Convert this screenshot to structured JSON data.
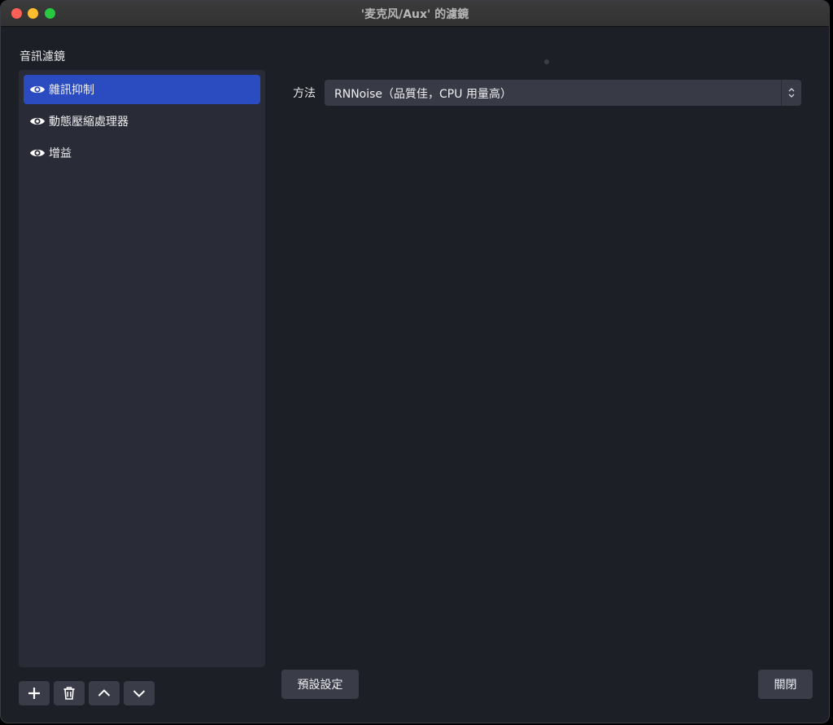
{
  "window": {
    "title": "'麦克风/Aux' 的濾鏡"
  },
  "filters": {
    "section_label": "音訊濾鏡",
    "items": [
      {
        "label": "雜訊抑制",
        "selected": true,
        "visible_icon": "eye-icon"
      },
      {
        "label": "動態壓縮處理器",
        "selected": false,
        "visible_icon": "eye-icon"
      },
      {
        "label": "增益",
        "selected": false,
        "visible_icon": "eye-icon"
      }
    ],
    "toolbar": {
      "add_icon": "plus-icon",
      "remove_icon": "trash-icon",
      "up_icon": "chevron-up-icon",
      "down_icon": "chevron-down-icon"
    }
  },
  "properties": {
    "method_label": "方法",
    "method_value": "RNNoise（品質佳，CPU 用量高）"
  },
  "buttons": {
    "defaults_label": "預設設定",
    "close_label": "關閉"
  },
  "colors": {
    "accent": "#2a4cc0",
    "background": "#1d1f27",
    "panel": "#292b36",
    "control": "#383b46"
  }
}
